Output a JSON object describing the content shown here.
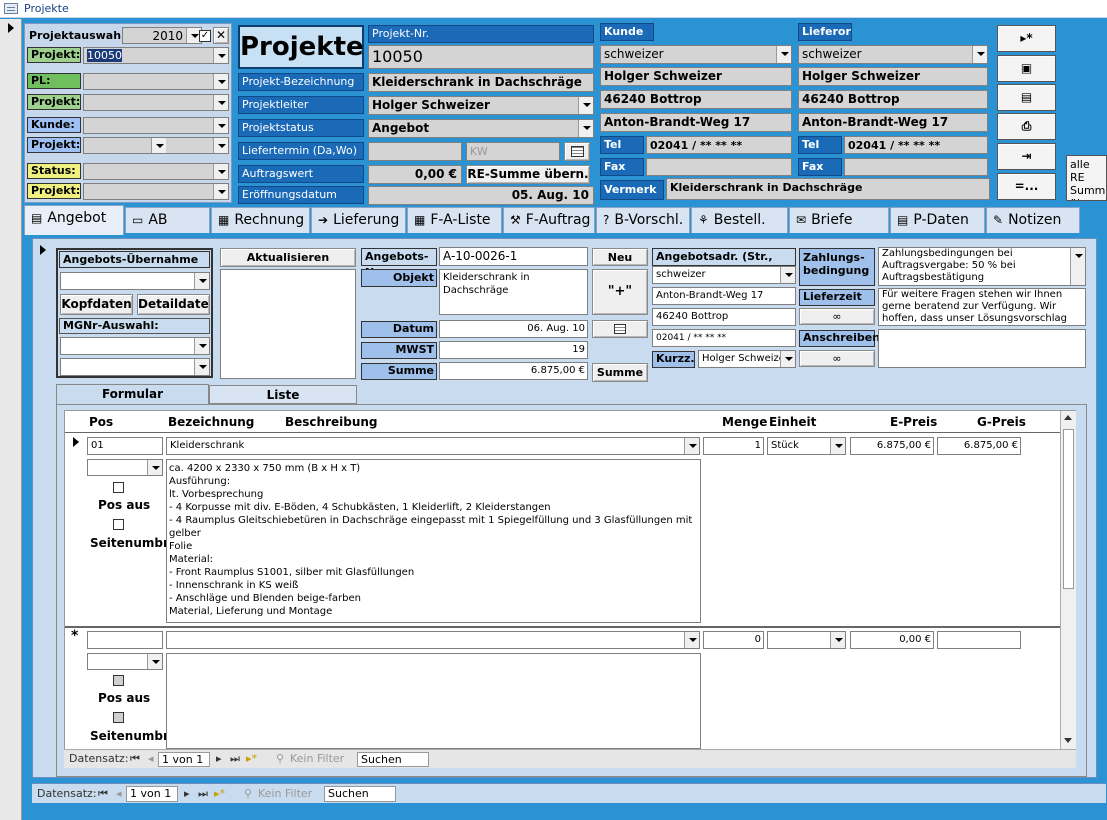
{
  "window": {
    "title": "Projekte"
  },
  "filter": {
    "heading": "Projektauswahl",
    "year": "2010",
    "rows": [
      {
        "label": "Projekt:",
        "value": "10050",
        "color": "#9ed08e"
      },
      {
        "label": "PL:",
        "value": "",
        "color": "#6fbf5e"
      },
      {
        "label": "Projekt:",
        "value": "",
        "color": "#9ed08e"
      },
      {
        "label": "Kunde:",
        "value": "",
        "color": "#9ec0f2"
      },
      {
        "label": "Projekt:",
        "value": "",
        "color": "#9ec0f2"
      },
      {
        "label": "Status:",
        "value": "",
        "color": "#f0f080"
      },
      {
        "label": "Projekt:",
        "value": "",
        "color": "#f0f080"
      }
    ]
  },
  "header": {
    "title": "Projekte",
    "projektnr_label": "Projekt-Nr.",
    "projektnr": "10050",
    "fields": [
      {
        "label": "Projekt-Bezeichnung",
        "value": "Kleiderschrank in Dachschräge",
        "combo": false
      },
      {
        "label": "Projektleiter",
        "value": "Holger Schweizer",
        "combo": true
      },
      {
        "label": "Projektstatus",
        "value": "Angebot",
        "combo": true
      },
      {
        "label": "Liefertermin (Da,Wo)",
        "value": "",
        "combo": false,
        "kw": "KW"
      },
      {
        "label": "Auftragswert",
        "value": "0,00 €",
        "combo": false,
        "button": "RE-Summe übern."
      },
      {
        "label": "Eröffnungsdatum",
        "value": "05. Aug. 10",
        "combo": false
      }
    ]
  },
  "kunde": {
    "label": "Kunde",
    "search": "schweizer",
    "name": "Holger Schweizer",
    "city": "46240  Bottrop",
    "street": "Anton-Brandt-Weg 17",
    "tel_label": "Tel",
    "tel": "02041 / ** ** **",
    "fax_label": "Fax",
    "fax": "",
    "vermerk_label": "Vermerk",
    "vermerk": "Kleiderschrank in Dachschräge"
  },
  "lieferort": {
    "label": "Lieferort",
    "search": "schweizer",
    "name": "Holger Schweizer",
    "city": "46240  Bottrop",
    "street": "Anton-Brandt-Weg 17",
    "tel_label": "Tel",
    "tel": "02041 / ** ** **",
    "fax_label": "Fax",
    "fax": ""
  },
  "right_buttons": [
    "▸*",
    "▣",
    "▤",
    "⎙",
    "⇥",
    "=..."
  ],
  "alle_re": "alle RE Summe übern",
  "tabs": [
    "Angebot",
    "AB",
    "Rechnung",
    "Lieferung",
    "F-A-Liste",
    "F-Auftrag",
    "B-Vorschl.",
    "Bestell.",
    "Briefe",
    "P-Daten",
    "Notizen"
  ],
  "angebot": {
    "uebernahme_label": "Angebots-Übernahme",
    "kopfdaten": "Kopfdaten",
    "detaildaten": "Detaildaten",
    "mgnr_label": "MGNr-Auswahl:",
    "aktualisieren": "Aktualisieren",
    "nr_label": "Angebots-Nr",
    "nr": "A-10-0026-1",
    "neu": "Neu",
    "plus": "\"+\"",
    "objekt_label": "Objekt",
    "objekt": "Kleiderschrank in Dachschräge",
    "datum_label": "Datum",
    "datum": "06. Aug. 10",
    "mwst_label": "MWST",
    "mwst": "19",
    "summe_label": "Summe",
    "summe": "6.875,00 €",
    "summe_btn": "Summe",
    "adr_label": "Angebotsadr. (Str., Ort)",
    "adr_search": "schweizer",
    "adr_street": "Anton-Brandt-Weg 17",
    "adr_city": "46240 Bottrop",
    "adr_tel": "02041 / ** ** **",
    "kurzz_label": "Kurzz.",
    "kurzz": "Holger Schweize",
    "zahlung_label": "Zahlungs-bedingung",
    "zahlung": "Zahlungsbedingungen bei Auftragsvergabe: 50 % bei Auftragsbestätigung",
    "lieferzeit_label": "Lieferzeit",
    "lieferzeit": "Für weitere Fragen stehen wir Ihnen gerne beratend zur Verfügung. Wir hoffen, dass unser Lösungsvorschlag",
    "anschreiben_label": "Anschreiben",
    "anschreiben": ""
  },
  "subtabs": [
    "Formular",
    "Liste"
  ],
  "grid": {
    "headers": {
      "pos": "Pos",
      "bez": "Bezeichnung",
      "beschr": "Beschreibung",
      "menge": "Menge",
      "einheit": "Einheit",
      "epreis": "E-Preis",
      "gpreis": "G-Preis"
    },
    "row": {
      "pos": "01",
      "bez": "Kleiderschrank",
      "menge": "1",
      "einheit": "Stück",
      "epreis": "6.875,00 €",
      "gpreis": "6.875,00 €",
      "desc": [
        "ca. 4200 x 2330 x 750 mm (B x H x T)",
        "Ausführung:",
        "lt. Vorbesprechung",
        "- 4 Korpusse mit div. E-Böden, 4 Schubkästen, 1 Kleiderlift, 2 Kleiderstangen",
        "- 4 Raumplus Gleitschiebetüren in Dachschräge eingepasst mit 1 Spiegelfüllung und 3 Glasfüllungen mit gelber",
        "Folie",
        "Material:",
        "- Front Raumplus S1001, silber mit Glasfüllungen",
        "- Innenschrank in KS weiß",
        "- Anschläge und Blenden beige-farben",
        "Material, Lieferung und Montage"
      ]
    },
    "newrow": {
      "menge": "0",
      "epreis": "0,00 €"
    },
    "pos_aus": "Pos aus",
    "seitenumbr": "Seitenumbr."
  },
  "nav_inner": {
    "label": "Datensatz:",
    "record": "1 von 1",
    "filter": "Kein Filter",
    "search": "Suchen"
  },
  "nav_outer": {
    "label": "Datensatz:",
    "record": "1 von 1",
    "filter": "Kein Filter",
    "search": "Suchen"
  }
}
